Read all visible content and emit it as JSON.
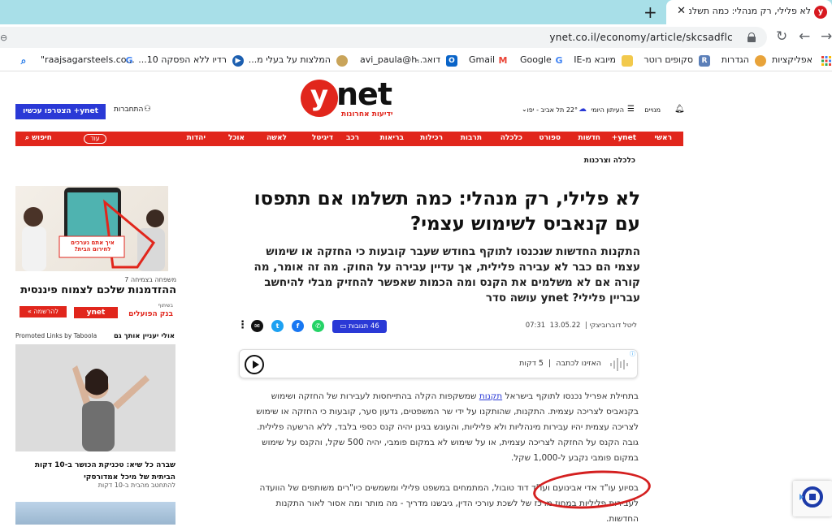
{
  "browser": {
    "tab_title": "לא פלילי, רק מנהלי: כמה תשלמו",
    "tab_favicon": "y",
    "tab_close": "✕",
    "new_tab": "+",
    "url": "ynet.co.il/economy/article/skcsadflc",
    "bookmarks": [
      {
        "label": "אפליקציות",
        "icon": "apps-grid-icon"
      },
      {
        "label": "הגדרות",
        "icon": "tiger-icon"
      },
      {
        "label": "סקופים רוטר",
        "icon": "rotter-icon"
      },
      {
        "label": "מיובא מ-IE",
        "icon": "folder-icon"
      },
      {
        "label": "Google",
        "icon": "google-icon"
      },
      {
        "label": "Gmail",
        "icon": "gmail-icon"
      },
      {
        "label": "דואר -",
        "icon": "outlook-icon"
      },
      {
        "label": "avi_paula@h...",
        "icon": "user-icon"
      },
      {
        "label": "המלצות על בעלי מ...",
        "icon": "bottle-icon"
      },
      {
        "label": "רדיו ללא הפסקה 10...",
        "icon": "radio-icon"
      },
      {
        "label": "\"raajsagarsteels.co...",
        "icon": "google-icon"
      },
      {
        "label": "",
        "icon": "search-icon"
      }
    ]
  },
  "header": {
    "logo_main": "net",
    "logo_y": "y",
    "logo_sub": "ידיעות אחרונות",
    "subscribe": "ynet+ הצטרפו עכשיו",
    "login": "התחברות",
    "subscribers": "מנויים",
    "daily_paper": "העיתון היומי",
    "weather": "22° תל אביב - יפו",
    "more": "עוד",
    "search": "חיפוש"
  },
  "nav": [
    "ראשי",
    "ynet+",
    "חדשות",
    "ספורט",
    "כלכלה",
    "תרבות",
    "רכילות",
    "בריאות",
    "רכב",
    "דיגיטל",
    "לאשה",
    "אוכל",
    "יהדות"
  ],
  "article": {
    "section": "כלכלה וצרכנות",
    "title": "לא פלילי, רק מנהלי: כמה תשלמו אם תתפסו עם קנאביס לשימוש עצמי?",
    "subtitle": "התקנות החדשות שנכנסו לתוקף בחודש שעבר קובעות כי החזקה או שימוש עצמי הם כבר לא עבירה פלילית, אך עדיין עבירה על החוק. מה זה אומר, מה קורה אם לא משלמים את הקנס ומה הכמות שאפשר להחזיק מבלי להיחשב עבריין פלילי? ynet עושה סדר",
    "author": "ליטל דוברוביצקי",
    "date": "13.05.22",
    "time": "07:31",
    "comments": "46 תגובות",
    "audio_label": "האזינו לכתבה",
    "audio_duration": "5 דקות",
    "body1_a": "בתחילת אפריל נכנסו לתוקף בישראל ",
    "body1_link": "תקנות",
    "body1_b": " שמשקפות הקלה בהתייחסות לעבירות של החזקה ושימוש בקנאביס לצריכה עצמית. התקנות, שהותקנו על ידי שר המשפטים, גדעון סער, קובעות כי החזקה או שימוש לצריכה עצמית יהיו עבירות מינהליות ולא פליליות, והעונש בגינן יהיה קנס כספי בלבד, ללא הרשעה פלילית. גובה הקנס על החזקה לצריכה עצמית, או על שימוש לא במקום פומבי, יהיה 500 שקל, והקנס על שימוש במקום פומבי נקבע ל-1,000 שקל.",
    "body2": "בסיוע עו\"ד אדי אבינועם ועו\"ד דוד טובול, המתמחים במשפט פלילי ומשמשים כיו\"רים משותפים של הוועדה לעבירות פליליות במחוז מרכז של לשכת עורכי הדין, גיבשנו מדריך - מה מותר ומה אסור לאור התקנות החדשות."
  },
  "sidebar": {
    "ad_sub": "משפחה בצמיחה 7",
    "ad_title": "ההזדמנות שלכם לצמוח פיננסית",
    "ad_phone_text": "איך אתם נערכים לחירום הבית?",
    "ad_sponsor_label": "בשיתוף",
    "ad_sponsor_bank": "בנק הפועלים",
    "ad_ynet": "ynet",
    "ad_cta": "להרשמה »",
    "taboola_left": "Promoted Links by Taboola",
    "taboola_right": "אולי יעניין אותך גם",
    "promo_caption": "שברה כל שיא: טכניקת הכושר ב-10 דקות הביתית של מיכל אמדורסקי",
    "promo_source": "להתחטב מהבית ב-10 דקות"
  }
}
